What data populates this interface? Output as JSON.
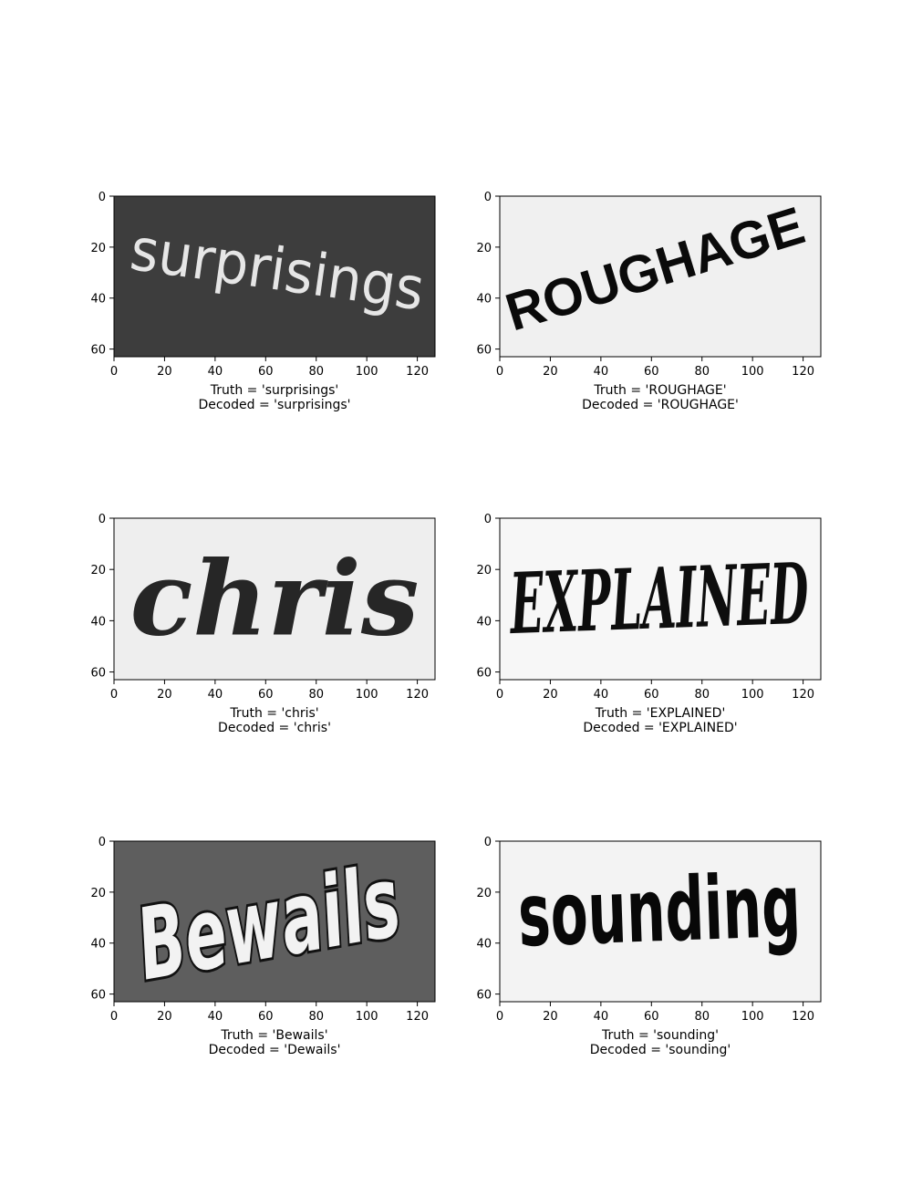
{
  "chart_data": [
    {
      "type": "image",
      "word": "surprisings",
      "truth_caption": "Truth = 'surprisings'",
      "decoded_caption": "Decoded = 'surprisings'",
      "x_ticks": [
        0,
        20,
        40,
        60,
        80,
        100,
        120
      ],
      "y_ticks": [
        0,
        20,
        40,
        60
      ],
      "xlim": [
        0,
        127
      ],
      "ylim": [
        63,
        0
      ],
      "background_color": "#3d3d3d",
      "text_color": "#e6e6e6"
    },
    {
      "type": "image",
      "word": "ROUGHAGE",
      "truth_caption": "Truth = 'ROUGHAGE'",
      "decoded_caption": "Decoded = 'ROUGHAGE'",
      "x_ticks": [
        0,
        20,
        40,
        60,
        80,
        100,
        120
      ],
      "y_ticks": [
        0,
        20,
        40,
        60
      ],
      "xlim": [
        0,
        127
      ],
      "ylim": [
        63,
        0
      ],
      "background_color": "#f0f0f0",
      "text_color": "#0a0a0a"
    },
    {
      "type": "image",
      "word": "chris",
      "truth_caption": "Truth = 'chris'",
      "decoded_caption": "Decoded = 'chris'",
      "x_ticks": [
        0,
        20,
        40,
        60,
        80,
        100,
        120
      ],
      "y_ticks": [
        0,
        20,
        40,
        60
      ],
      "xlim": [
        0,
        127
      ],
      "ylim": [
        63,
        0
      ],
      "background_color": "#eeeeee",
      "text_color": "#262626"
    },
    {
      "type": "image",
      "word": "EXPLAINED",
      "truth_caption": "Truth = 'EXPLAINED'",
      "decoded_caption": "Decoded = 'EXPLAINED'",
      "x_ticks": [
        0,
        20,
        40,
        60,
        80,
        100,
        120
      ],
      "y_ticks": [
        0,
        20,
        40,
        60
      ],
      "xlim": [
        0,
        127
      ],
      "ylim": [
        63,
        0
      ],
      "background_color": "#f7f7f7",
      "text_color": "#0d0d0d"
    },
    {
      "type": "image",
      "word": "Bewails",
      "truth_caption": "Truth = 'Bewails'",
      "decoded_caption": "Decoded = 'Dewails'",
      "x_ticks": [
        0,
        20,
        40,
        60,
        80,
        100,
        120
      ],
      "y_ticks": [
        0,
        20,
        40,
        60
      ],
      "xlim": [
        0,
        127
      ],
      "ylim": [
        63,
        0
      ],
      "background_color": "#5e5e5e",
      "text_color": "#f2f2f2"
    },
    {
      "type": "image",
      "word": "sounding",
      "truth_caption": "Truth = 'sounding'",
      "decoded_caption": "Decoded = 'sounding'",
      "x_ticks": [
        0,
        20,
        40,
        60,
        80,
        100,
        120
      ],
      "y_ticks": [
        0,
        20,
        40,
        60
      ],
      "xlim": [
        0,
        127
      ],
      "ylim": [
        63,
        0
      ],
      "background_color": "#f3f3f3",
      "text_color": "#080808"
    }
  ]
}
